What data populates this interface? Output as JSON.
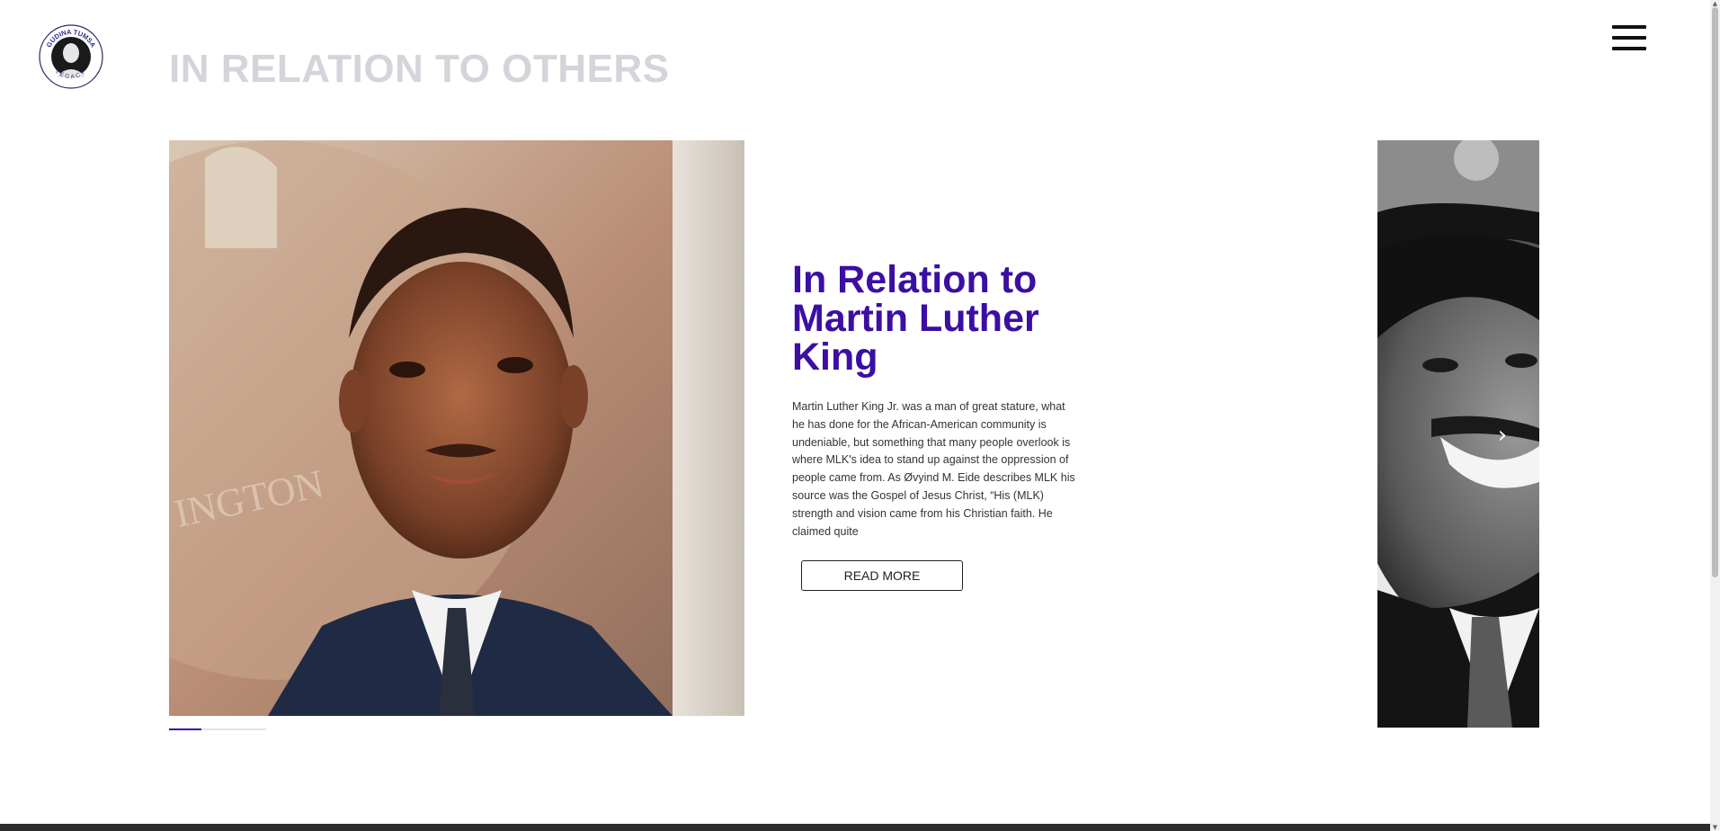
{
  "header": {
    "logo_text_top": "GUDINA TUMSA",
    "logo_text_bottom": "LEGACY",
    "page_title": "IN RELATION TO OTHERS",
    "menu_icon": "hamburger-menu-icon"
  },
  "slide": {
    "heading": "In Relation to Martin Luther King",
    "body": "Martin Luther King Jr. was a man of great stature, what he has done for the African-American community is undeniable, but something that many people overlook is where MLK's idea to stand up against the oppression of people came from. As Øvyind M. Eide describes MLK his source was the Gospel of Jesus Christ, “His (MLK) strength and vision came from his Christian faith. He claimed quite",
    "read_more_label": "READ MORE"
  },
  "carousel": {
    "next_arrow_icon": "chevron-right-icon",
    "next_arrow_glyph": "›",
    "progress_fraction": 0.33,
    "accent_color": "#3b0ea4"
  },
  "colors": {
    "title_gray": "#d4d5db",
    "heading_purple": "#3b0ea4",
    "footer_dark": "#2b2b2b"
  }
}
